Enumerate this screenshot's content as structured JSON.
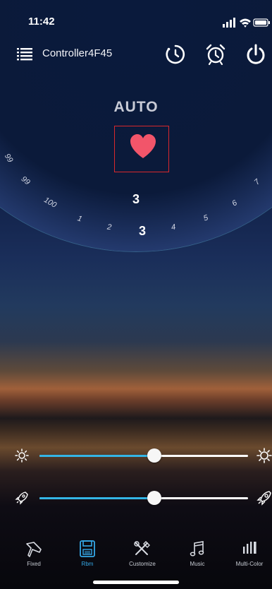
{
  "status_bar": {
    "time": "11:42"
  },
  "header": {
    "device_name": "Controller4F45",
    "icons": [
      "menu-icon",
      "timer-icon",
      "alarm-clock-icon",
      "power-icon"
    ]
  },
  "dial": {
    "mode": "AUTO",
    "current_value": "3",
    "ticks": [
      "99",
      "99",
      "100",
      "1",
      "2",
      "3",
      "4",
      "5",
      "6",
      "7"
    ],
    "selected_tick": "3",
    "icon": "heart-icon"
  },
  "sliders": [
    {
      "name": "brightness",
      "left_icon": "sun-small-icon",
      "right_icon": "sun-large-icon",
      "value": 0.55
    },
    {
      "name": "speed",
      "left_icon": "rocket-small-icon",
      "right_icon": "rocket-large-icon",
      "value": 0.55
    }
  ],
  "tabs": [
    {
      "label": "Fixed",
      "icon": "pin-icon",
      "active": false
    },
    {
      "label": "Rbm",
      "icon": "save-icon",
      "active": true
    },
    {
      "label": "Customize",
      "icon": "customize-icon",
      "active": false
    },
    {
      "label": "Music",
      "icon": "music-icon",
      "active": false
    },
    {
      "label": "Multi-Color",
      "icon": "bars-icon",
      "active": false
    }
  ],
  "colors": {
    "accent": "#35a9e8",
    "heart": "#f2556a",
    "highlight_box": "#d8282c"
  }
}
